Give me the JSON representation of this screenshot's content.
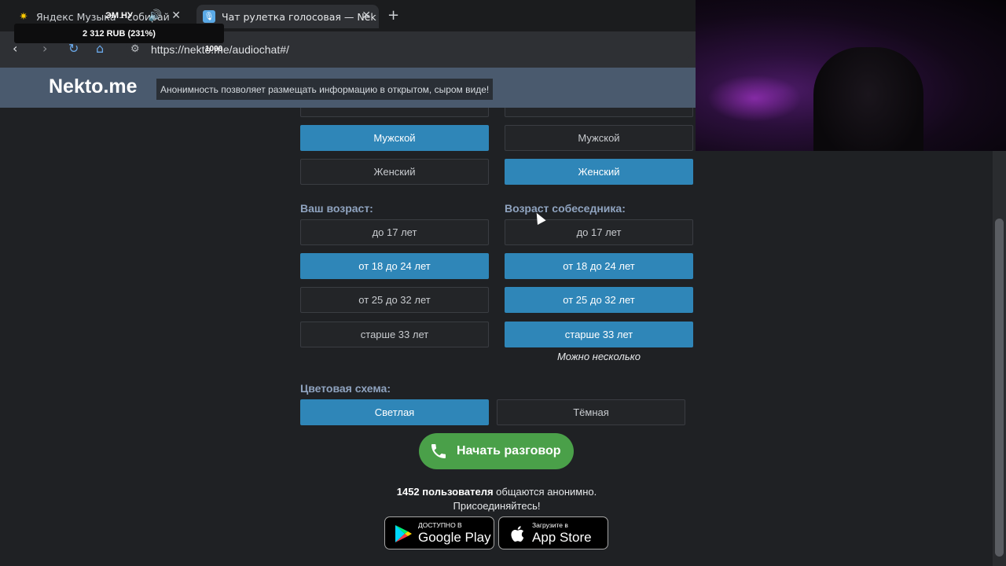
{
  "browser": {
    "tabs": [
      {
        "title": "Яндекс Музыка – собирай",
        "icon": "yandex-music-icon",
        "audio": "speaker-icon"
      },
      {
        "title": "Чат рулетка голосовая — Nek",
        "icon": "microphone-icon"
      }
    ],
    "url": "https://nekto.me/audiochat#/",
    "url_overlay": "1000"
  },
  "overlay": {
    "ticker_top": "ЭМ НУ",
    "ticker": "2 312 RUB (231%)"
  },
  "site": {
    "logo": "Nekto.me",
    "slogan": "Анонимность позволяет размещать информацию в открытом, сыром виде!"
  },
  "gender": {
    "mine": [
      {
        "label": "Мужской",
        "selected": true
      },
      {
        "label": "Женский",
        "selected": false
      }
    ],
    "partner": [
      {
        "label": "Мужской",
        "selected": false
      },
      {
        "label": "Женский",
        "selected": true
      }
    ]
  },
  "age": {
    "mine_label": "Ваш возраст:",
    "partner_label": "Возраст собеседника:",
    "mine": [
      {
        "label": "до 17 лет",
        "selected": false
      },
      {
        "label": "от 18 до 24 лет",
        "selected": true
      },
      {
        "label": "от 25 до 32 лет",
        "selected": false
      },
      {
        "label": "старше 33 лет",
        "selected": false
      }
    ],
    "partner": [
      {
        "label": "до 17 лет",
        "selected": false
      },
      {
        "label": "от 18 до 24 лет",
        "selected": true
      },
      {
        "label": "от 25 до 32 лет",
        "selected": true
      },
      {
        "label": "старше 33 лет",
        "selected": true
      }
    ],
    "hint": "Можно несколько"
  },
  "theme": {
    "label": "Цветовая схема:",
    "options": [
      {
        "label": "Светлая",
        "selected": true
      },
      {
        "label": "Тёмная",
        "selected": false
      }
    ]
  },
  "start": {
    "label": "Начать разговор",
    "icon": "phone-icon"
  },
  "online": {
    "count": "1452 пользователя",
    "text": " общаются анонимно.",
    "line2": "Присоединяйтесь!"
  },
  "stores": {
    "google": {
      "small": "ДОСТУПНО В",
      "big": "Google Play"
    },
    "apple": {
      "small": "Загрузите в",
      "big": "App Store"
    }
  },
  "colors": {
    "accent": "#2f86b8",
    "start": "#4aa049",
    "header": "#4a5a6e",
    "background": "#1f2124"
  }
}
